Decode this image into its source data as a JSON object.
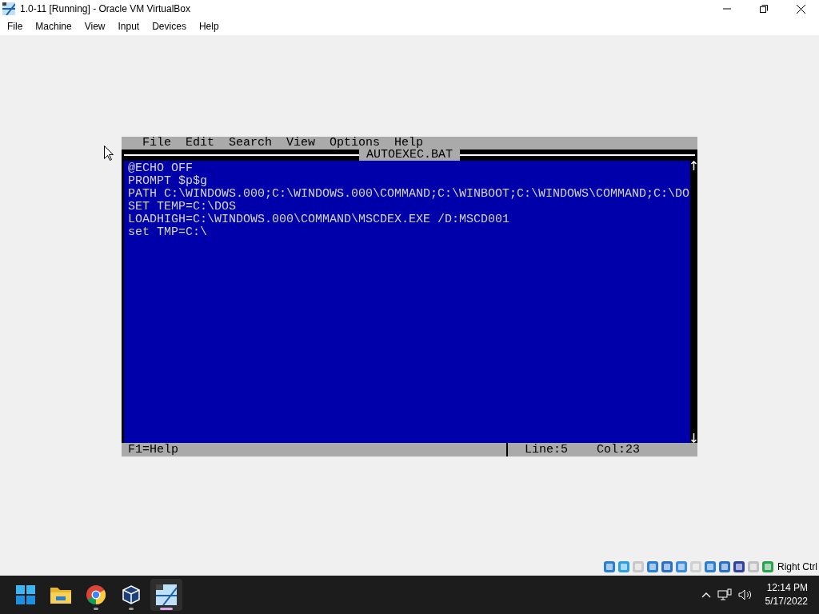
{
  "window": {
    "title": "1.0-11 [Running] - Oracle VM VirtualBox"
  },
  "menu": [
    "File",
    "Machine",
    "View",
    "Input",
    "Devices",
    "Help"
  ],
  "editor": {
    "menu": [
      "File",
      "Edit",
      "Search",
      "View",
      "Options",
      "Help"
    ],
    "title": "AUTOEXEC.BAT",
    "lines": [
      "@ECHO OFF",
      "PROMPT $p$g",
      "PATH C:\\WINDOWS.000;C:\\WINDOWS.000\\COMMAND;C:\\WINBOOT;C:\\WINDOWS\\COMMAND;C:\\DO",
      "SET TEMP=C:\\DOS",
      "LOADHIGH=C:\\WINDOWS.000\\COMMAND\\MSCDEX.EXE /D:MSCD001",
      "set TMP=C:\\"
    ],
    "status": {
      "help": "F1=Help",
      "line": "Line:5",
      "col": "Col:23"
    }
  },
  "host_key": "Right Ctrl",
  "taskbar": {
    "apps": [
      {
        "kind": "start",
        "running": false,
        "selected": false
      },
      {
        "kind": "folder",
        "running": false,
        "selected": false
      },
      {
        "kind": "chrome",
        "running": true,
        "selected": false
      },
      {
        "kind": "vbox",
        "running": true,
        "selected": false
      },
      {
        "kind": "vm",
        "running": true,
        "selected": true
      }
    ],
    "time": "12:14 PM",
    "date": "5/17/2022"
  }
}
